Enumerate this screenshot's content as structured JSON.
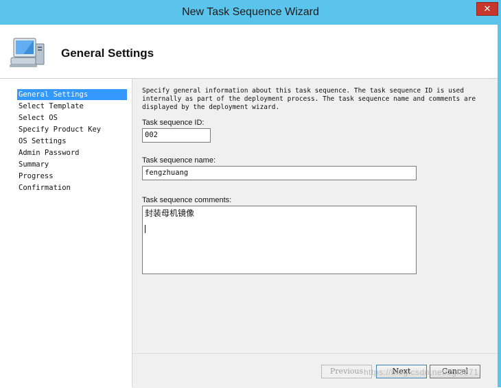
{
  "window": {
    "title": "New Task Sequence Wizard",
    "close_glyph": "✕",
    "colors": {
      "titlebar": "#5bc4ec",
      "close": "#c7372d",
      "nav_selected": "#3399ff"
    }
  },
  "header": {
    "title": "General Settings",
    "icon": "computer-icon"
  },
  "nav": {
    "items": [
      {
        "label": "General Settings",
        "active": true
      },
      {
        "label": "Select Template",
        "active": false
      },
      {
        "label": "Select OS",
        "active": false
      },
      {
        "label": "Specify Product Key",
        "active": false
      },
      {
        "label": "OS Settings",
        "active": false
      },
      {
        "label": "Admin Password",
        "active": false
      },
      {
        "label": "Summary",
        "active": false
      },
      {
        "label": "Progress",
        "active": false
      },
      {
        "label": "Confirmation",
        "active": false
      }
    ]
  },
  "form": {
    "description": "Specify general information about this task sequence.  The task sequence ID is used internally as part of the deployment process.  The task sequence name and comments are displayed by the deployment wizard.",
    "id_label": "Task sequence ID:",
    "id_value": "002",
    "name_label": "Task sequence name:",
    "name_value": "fengzhuang",
    "comments_label": "Task sequence comments:",
    "comments_value": "封装母机镜像"
  },
  "footer": {
    "previous_label": "Previous",
    "next_label": "Next",
    "cancel_label": "Cancel",
    "previous_enabled": false
  },
  "watermark": "https://blog.csdn.net/zgl3371"
}
